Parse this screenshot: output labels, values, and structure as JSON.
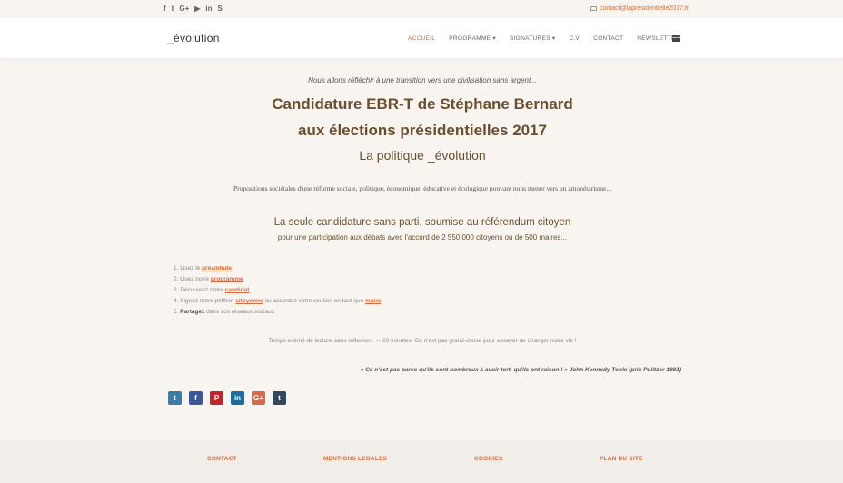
{
  "topbar": {
    "social_icons": [
      {
        "name": "facebook-icon",
        "glyph": "f"
      },
      {
        "name": "twitter-icon",
        "glyph": "t"
      },
      {
        "name": "google-plus-icon",
        "glyph": "G+"
      },
      {
        "name": "youtube-icon",
        "glyph": "▶"
      },
      {
        "name": "linkedin-icon",
        "glyph": "in"
      },
      {
        "name": "skype-icon",
        "glyph": "S"
      }
    ],
    "email": "contact@lapresidentielle2017.fr"
  },
  "header": {
    "logo": "_évolution",
    "nav": [
      {
        "label": "ACCUEIL",
        "active": true
      },
      {
        "label": "PROGRAMME ▾",
        "active": false
      },
      {
        "label": "SIGNATURES ▾",
        "active": false
      },
      {
        "label": "C.V",
        "active": false
      },
      {
        "label": "CONTACT",
        "active": false
      },
      {
        "label": "NEWSLETTER",
        "active": false
      }
    ]
  },
  "main": {
    "intro": "Nous allons réfléchir à une transition vers une civilisation sans argent...",
    "title_line1": "Candidature EBR-T de Stéphane Bernard",
    "title_line2": "aux élections présidentielles 2017",
    "subtitle": "La politique _évolution",
    "proposals": "Propositions sociétales d'une réforme sociale, politique, économique, éducative et écologique pouvant nous mener vers un amonétarisme...",
    "tagline": "La seule candidature sans parti, soumise au référendum citoyen",
    "tagline_sub": "pour une participation aux débats avec l'accord de 2 550 000 citoyens ou de 500 maires...",
    "steps": [
      {
        "before": "1. Lisez le ",
        "link": "préambule",
        "after": ""
      },
      {
        "before": "2. Lisez notre ",
        "link": "programme",
        "after": ""
      },
      {
        "before": "3. Découvrez notre ",
        "link": "candidat",
        "after": ""
      },
      {
        "before": "4. Signez notre pétition ",
        "link": "citoyenne",
        "after": " ou accordez votre soutien en tant que ",
        "link2": "maire"
      },
      {
        "before": "5. ",
        "bold": "Partagez",
        "after": " dans vos réseaux sociaux"
      }
    ],
    "reading_time": "Temps estimé de lecture sans réflexion : +- 20 minutes. Ce n'est pas grand-chose pour essayer de changer notre vie !",
    "quote": "« Ce n'est pas parce qu'ils sont nombreux à avoir tort, qu'ils ont raison ! » John Kennedy Toole (prix Pulitzer 1981)"
  },
  "share_icons": [
    {
      "name": "twitter-share-icon",
      "glyph": "t",
      "color": "#3a7ea8"
    },
    {
      "name": "facebook-share-icon",
      "glyph": "f",
      "color": "#3b5998"
    },
    {
      "name": "pinterest-share-icon",
      "glyph": "P",
      "color": "#c8232c"
    },
    {
      "name": "linkedin-share-icon",
      "glyph": "in",
      "color": "#1f6ba0"
    },
    {
      "name": "google-plus-share-icon",
      "glyph": "G+",
      "color": "#d8694b"
    },
    {
      "name": "tumblr-share-icon",
      "glyph": "t",
      "color": "#34465d"
    }
  ],
  "footer": {
    "links": [
      "CONTACT",
      "MENTIONS LEGALES",
      "COOKIES",
      "PLAN DU SITE"
    ]
  },
  "colors": {
    "accent": "#d86b3a",
    "heading": "#6b5030",
    "background": "#f8f5f1"
  }
}
